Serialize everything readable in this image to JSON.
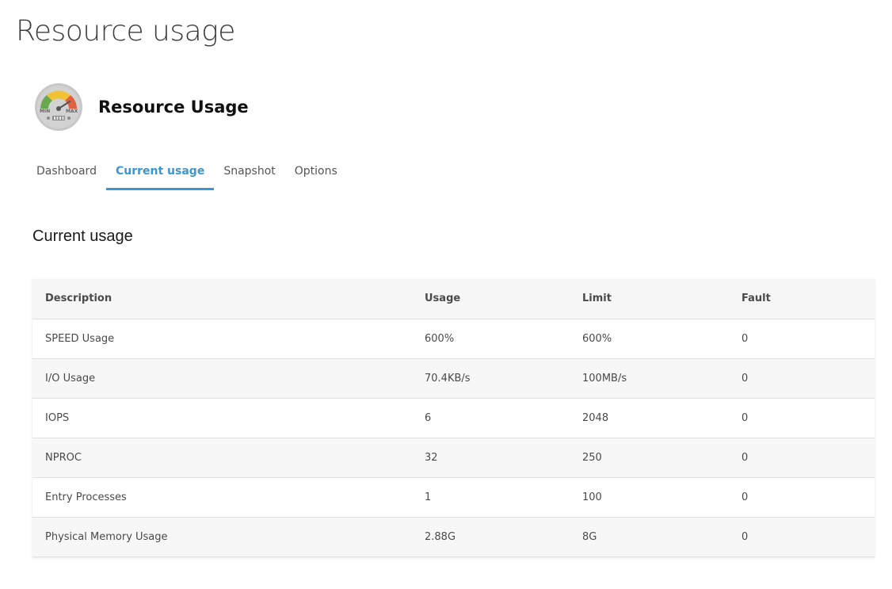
{
  "page": {
    "title": "Resource usage"
  },
  "plugin": {
    "title": "Resource Usage",
    "icon": "speedometer-gauge-icon",
    "icon_labels": {
      "min": "MIN",
      "max": "MAX"
    }
  },
  "tabs": [
    {
      "label": "Dashboard",
      "active": false
    },
    {
      "label": "Current usage",
      "active": true
    },
    {
      "label": "Snapshot",
      "active": false
    },
    {
      "label": "Options",
      "active": false
    }
  ],
  "section": {
    "title": "Current usage"
  },
  "table": {
    "columns": [
      "Description",
      "Usage",
      "Limit",
      "Fault"
    ],
    "rows": [
      [
        "SPEED Usage",
        "600%",
        "600%",
        "0"
      ],
      [
        "I/O Usage",
        "70.4KB/s",
        "100MB/s",
        "0"
      ],
      [
        "IOPS",
        "6",
        "2048",
        "0"
      ],
      [
        "NPROC",
        "32",
        "250",
        "0"
      ],
      [
        "Entry Processes",
        "1",
        "100",
        "0"
      ],
      [
        "Physical Memory Usage",
        "2.88G",
        "8G",
        "0"
      ]
    ]
  },
  "colors": {
    "accent": "#3b97d3",
    "gauge_green": "#6aa84f",
    "gauge_yellow": "#f1c232",
    "gauge_red": "#e06040",
    "gauge_body": "#c7c7c7"
  }
}
